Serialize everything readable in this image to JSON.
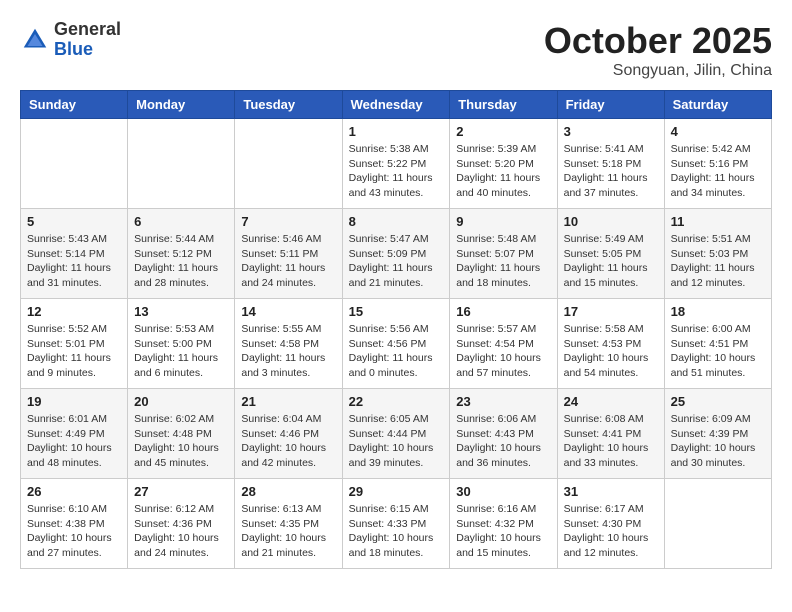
{
  "header": {
    "logo_general": "General",
    "logo_blue": "Blue",
    "month_title": "October 2025",
    "location": "Songyuan, Jilin, China"
  },
  "weekdays": [
    "Sunday",
    "Monday",
    "Tuesday",
    "Wednesday",
    "Thursday",
    "Friday",
    "Saturday"
  ],
  "weeks": [
    [
      {
        "day": "",
        "info": ""
      },
      {
        "day": "",
        "info": ""
      },
      {
        "day": "",
        "info": ""
      },
      {
        "day": "1",
        "info": "Sunrise: 5:38 AM\nSunset: 5:22 PM\nDaylight: 11 hours and 43 minutes."
      },
      {
        "day": "2",
        "info": "Sunrise: 5:39 AM\nSunset: 5:20 PM\nDaylight: 11 hours and 40 minutes."
      },
      {
        "day": "3",
        "info": "Sunrise: 5:41 AM\nSunset: 5:18 PM\nDaylight: 11 hours and 37 minutes."
      },
      {
        "day": "4",
        "info": "Sunrise: 5:42 AM\nSunset: 5:16 PM\nDaylight: 11 hours and 34 minutes."
      }
    ],
    [
      {
        "day": "5",
        "info": "Sunrise: 5:43 AM\nSunset: 5:14 PM\nDaylight: 11 hours and 31 minutes."
      },
      {
        "day": "6",
        "info": "Sunrise: 5:44 AM\nSunset: 5:12 PM\nDaylight: 11 hours and 28 minutes."
      },
      {
        "day": "7",
        "info": "Sunrise: 5:46 AM\nSunset: 5:11 PM\nDaylight: 11 hours and 24 minutes."
      },
      {
        "day": "8",
        "info": "Sunrise: 5:47 AM\nSunset: 5:09 PM\nDaylight: 11 hours and 21 minutes."
      },
      {
        "day": "9",
        "info": "Sunrise: 5:48 AM\nSunset: 5:07 PM\nDaylight: 11 hours and 18 minutes."
      },
      {
        "day": "10",
        "info": "Sunrise: 5:49 AM\nSunset: 5:05 PM\nDaylight: 11 hours and 15 minutes."
      },
      {
        "day": "11",
        "info": "Sunrise: 5:51 AM\nSunset: 5:03 PM\nDaylight: 11 hours and 12 minutes."
      }
    ],
    [
      {
        "day": "12",
        "info": "Sunrise: 5:52 AM\nSunset: 5:01 PM\nDaylight: 11 hours and 9 minutes."
      },
      {
        "day": "13",
        "info": "Sunrise: 5:53 AM\nSunset: 5:00 PM\nDaylight: 11 hours and 6 minutes."
      },
      {
        "day": "14",
        "info": "Sunrise: 5:55 AM\nSunset: 4:58 PM\nDaylight: 11 hours and 3 minutes."
      },
      {
        "day": "15",
        "info": "Sunrise: 5:56 AM\nSunset: 4:56 PM\nDaylight: 11 hours and 0 minutes."
      },
      {
        "day": "16",
        "info": "Sunrise: 5:57 AM\nSunset: 4:54 PM\nDaylight: 10 hours and 57 minutes."
      },
      {
        "day": "17",
        "info": "Sunrise: 5:58 AM\nSunset: 4:53 PM\nDaylight: 10 hours and 54 minutes."
      },
      {
        "day": "18",
        "info": "Sunrise: 6:00 AM\nSunset: 4:51 PM\nDaylight: 10 hours and 51 minutes."
      }
    ],
    [
      {
        "day": "19",
        "info": "Sunrise: 6:01 AM\nSunset: 4:49 PM\nDaylight: 10 hours and 48 minutes."
      },
      {
        "day": "20",
        "info": "Sunrise: 6:02 AM\nSunset: 4:48 PM\nDaylight: 10 hours and 45 minutes."
      },
      {
        "day": "21",
        "info": "Sunrise: 6:04 AM\nSunset: 4:46 PM\nDaylight: 10 hours and 42 minutes."
      },
      {
        "day": "22",
        "info": "Sunrise: 6:05 AM\nSunset: 4:44 PM\nDaylight: 10 hours and 39 minutes."
      },
      {
        "day": "23",
        "info": "Sunrise: 6:06 AM\nSunset: 4:43 PM\nDaylight: 10 hours and 36 minutes."
      },
      {
        "day": "24",
        "info": "Sunrise: 6:08 AM\nSunset: 4:41 PM\nDaylight: 10 hours and 33 minutes."
      },
      {
        "day": "25",
        "info": "Sunrise: 6:09 AM\nSunset: 4:39 PM\nDaylight: 10 hours and 30 minutes."
      }
    ],
    [
      {
        "day": "26",
        "info": "Sunrise: 6:10 AM\nSunset: 4:38 PM\nDaylight: 10 hours and 27 minutes."
      },
      {
        "day": "27",
        "info": "Sunrise: 6:12 AM\nSunset: 4:36 PM\nDaylight: 10 hours and 24 minutes."
      },
      {
        "day": "28",
        "info": "Sunrise: 6:13 AM\nSunset: 4:35 PM\nDaylight: 10 hours and 21 minutes."
      },
      {
        "day": "29",
        "info": "Sunrise: 6:15 AM\nSunset: 4:33 PM\nDaylight: 10 hours and 18 minutes."
      },
      {
        "day": "30",
        "info": "Sunrise: 6:16 AM\nSunset: 4:32 PM\nDaylight: 10 hours and 15 minutes."
      },
      {
        "day": "31",
        "info": "Sunrise: 6:17 AM\nSunset: 4:30 PM\nDaylight: 10 hours and 12 minutes."
      },
      {
        "day": "",
        "info": ""
      }
    ]
  ]
}
